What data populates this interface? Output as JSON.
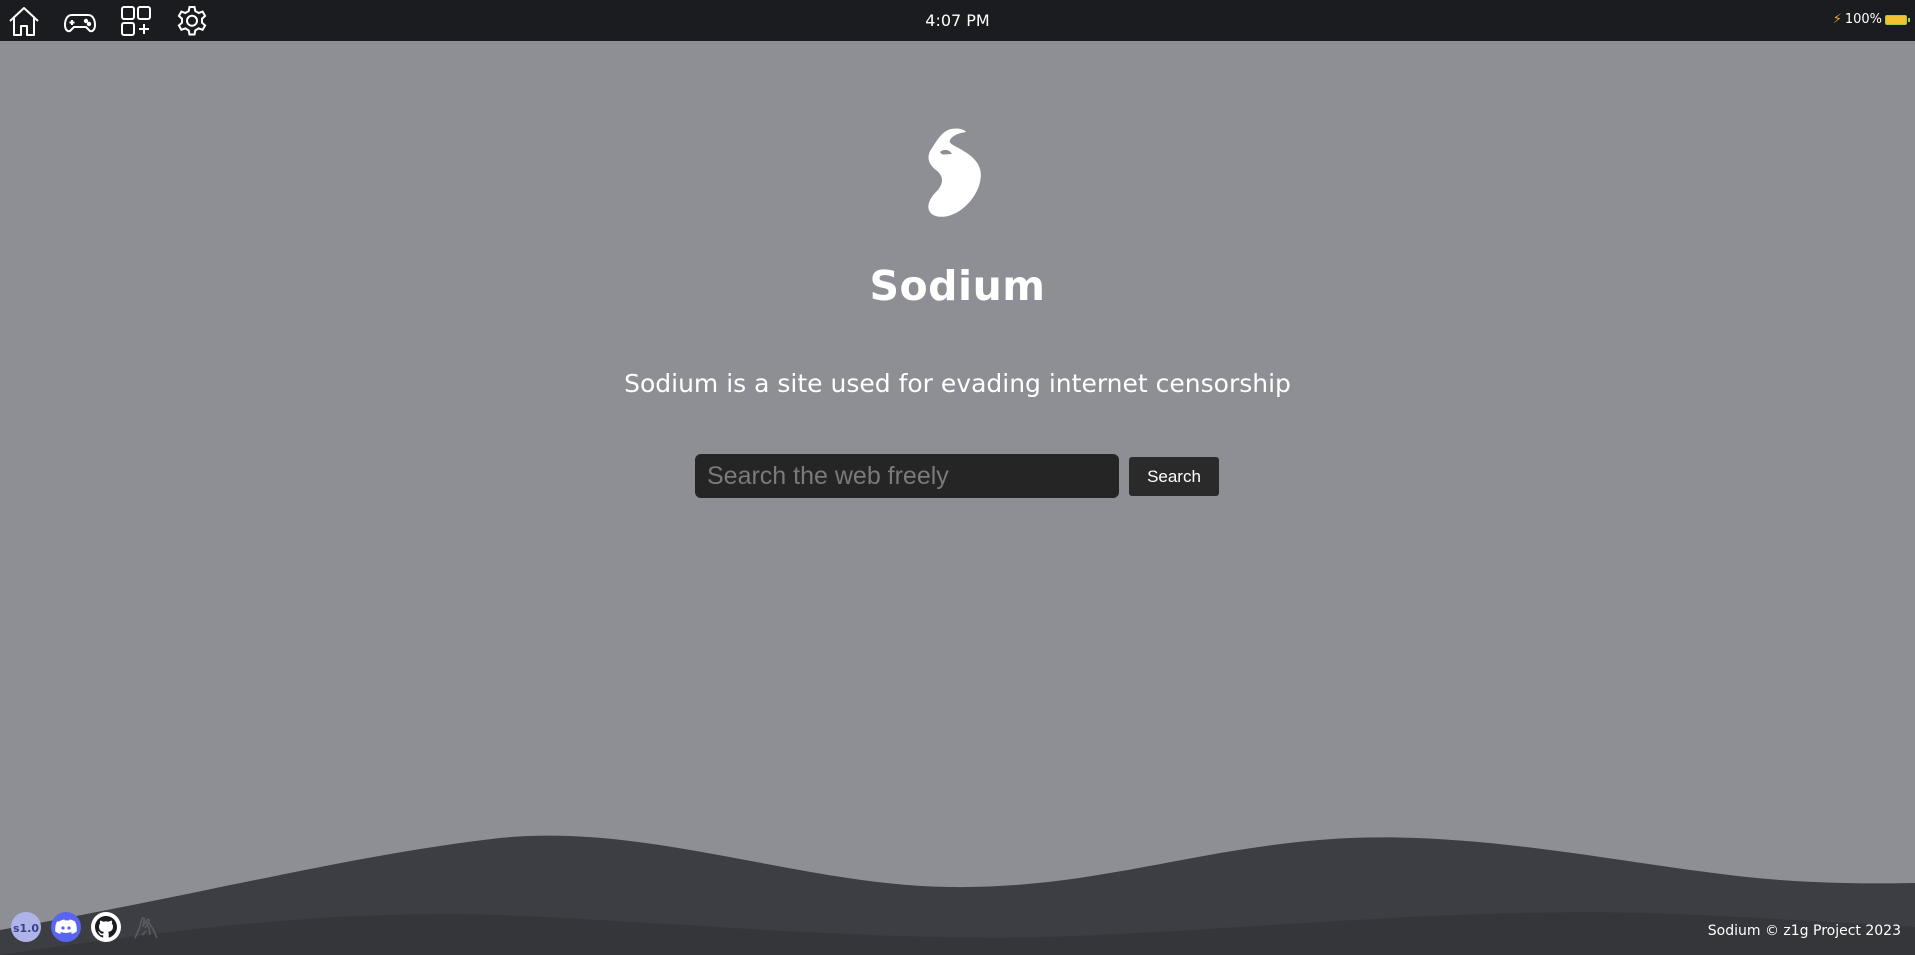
{
  "topbar": {
    "clock": "4:07 PM",
    "battery_text": "100%",
    "icons": [
      "home-icon",
      "gamepad-icon",
      "apps-add-icon",
      "gear-icon"
    ]
  },
  "main": {
    "logo_icon": "sodium-logo-icon",
    "title": "Sodium",
    "tagline": "Sodium is a site used for evading internet censorship",
    "search_placeholder": "Search the web freely",
    "search_button": "Search"
  },
  "footer": {
    "icons": [
      "partner-badge-icon",
      "discord-icon",
      "github-icon",
      "hands-icon"
    ],
    "copyright": "Sodium © z1g Project 2023"
  },
  "colors": {
    "background": "#8e8f94",
    "topbar": "#1b1c1f",
    "wave": "#3d3e43",
    "input_bg": "#252525",
    "button_bg": "#2a2a2a",
    "discord": "#5865f2"
  }
}
